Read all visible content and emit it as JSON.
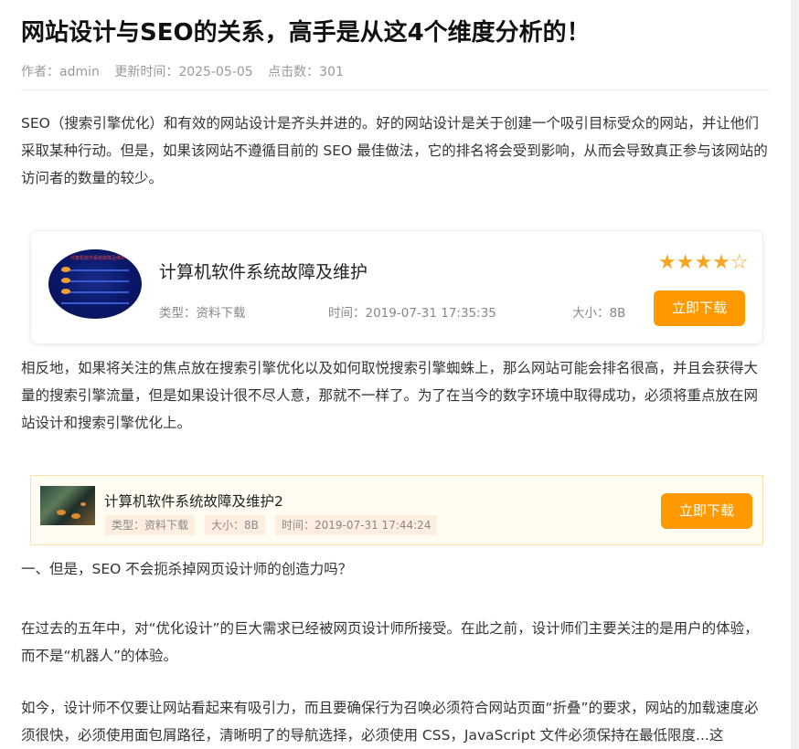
{
  "article": {
    "title": "网站设计与SEO的关系，高手是从这4个维度分析的！",
    "author_label": "作者：admin",
    "updated_label": "更新时间：2025-05-05",
    "clicks_label": "点击数：301",
    "paragraphs": [
      "SEO（搜索引擎优化）和有效的网站设计是齐头并进的。好的网站设计是关于创建一个吸引目标受众的网站，并让他们采取某种行动。但是，如果该网站不遵循目前的 SEO 最佳做法，它的排名将会受到影响，从而会导致真正参与该网站的访问者的数量的较少。",
      "相反地，如果将关注的焦点放在搜索引擎优化以及如何取悦搜索引擎蜘蛛上，那么网站可能会排名很高，并且会获得大量的搜索引擎流量，但是如果设计很不尽人意，那就不一样了。为了在当今的数字环境中取得成功，必须将重点放在网站设计和搜索引擎优化上。",
      "一、但是，SEO 不会扼杀掉网页设计师的创造力吗？",
      "在过去的五年中，对“优化设计”的巨大需求已经被网页设计师所接受。在此之前，设计师们主要关注的是用户的体验，而不是“机器人”的体验。",
      "如今，设计师不仅要让网站看起来有吸引力，而且要确保行为召唤必须符合网站页面“折叠”的要求，网站的加载速度必须很快，必须使用面包屑路径，清晰明了的导航选择，必须使用 CSS，JavaScript 文件必须保持在最低限度...这"
    ]
  },
  "download_card_1": {
    "title": "计算机软件系统故障及维护",
    "type_label": "类型：资料下载",
    "time_label": "时间：2019-07-31 17:35:35",
    "size_label": "大小：8B",
    "rating_stars": "★★★★☆",
    "rating": 4,
    "rating_max": 5,
    "button_label": "立即下载",
    "thumbnail_caption": "计算机软件系统故障及维护"
  },
  "download_card_2": {
    "title": "计算机软件系统故障及维护2",
    "type_label": "类型：资料下载",
    "size_label": "大小：8B",
    "time_label": "时间：2019-07-31 17:44:24",
    "button_label": "立即下载"
  },
  "colors": {
    "accent": "#ff9900",
    "star": "#f5a623",
    "tag_bg": "#fdeee0",
    "card2_bg": "#fffdf2"
  }
}
